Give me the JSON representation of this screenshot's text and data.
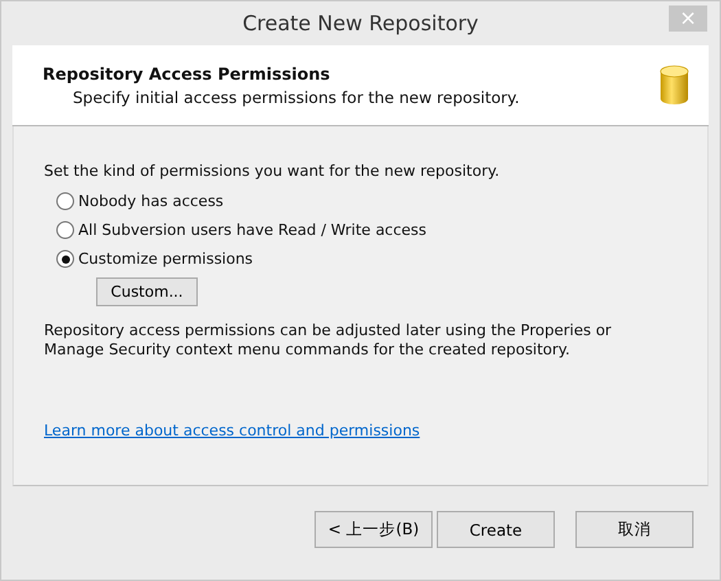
{
  "window": {
    "title": "Create New Repository",
    "close_icon": "×"
  },
  "header": {
    "title": "Repository Access Permissions",
    "subtitle": "Specify initial access permissions for the new repository."
  },
  "prompt": "Set the kind of permissions you want for the new repository.",
  "options": [
    {
      "label": "Nobody has access",
      "selected": false
    },
    {
      "label": "All Subversion users have Read / Write access",
      "selected": false
    },
    {
      "label": "Customize permissions",
      "selected": true
    }
  ],
  "custom_button": "Custom...",
  "note": "Repository access permissions can be adjusted later using the Properies or Manage Security context menu commands for the created repository.",
  "link": "Learn more about access control and permissions",
  "buttons": [
    {
      "label": "< 上一步(B)",
      "kind": "back"
    },
    {
      "label": "Create",
      "kind": "create"
    },
    {
      "label": "取消",
      "kind": "cancel"
    }
  ]
}
